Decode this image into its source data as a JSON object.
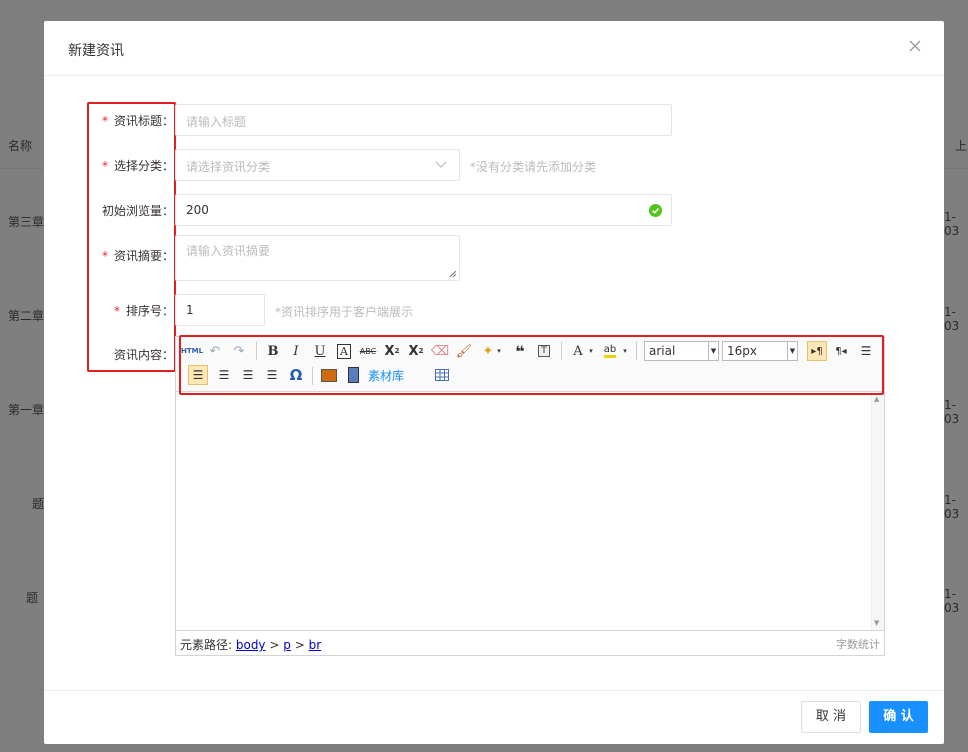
{
  "background": {
    "column_name": "名称",
    "column_upload": "上",
    "rows": [
      {
        "name": "第三章",
        "date": "1-03"
      },
      {
        "name": "第二章",
        "date": "1-03"
      },
      {
        "name": "第一章",
        "date": "1-03"
      },
      {
        "name": "题",
        "date": "1-03"
      },
      {
        "name": "题",
        "date": "1-03"
      }
    ]
  },
  "dialog": {
    "title": "新建资讯",
    "cancel_label": "取 消",
    "confirm_label": "确 认"
  },
  "form": {
    "title_label": "资讯标题：",
    "title_placeholder": "请输入标题",
    "category_label": "选择分类：",
    "category_placeholder": "请选择资讯分类",
    "category_hint": "*没有分类请先添加分类",
    "views_label": "初始浏览量：",
    "views_value": "200",
    "summary_label": "资讯摘要：",
    "summary_placeholder": "请输入资讯摘要",
    "sort_label": "排序号：",
    "sort_value": "1",
    "sort_hint": "*资讯排序用于客户端展示",
    "content_label": "资讯内容："
  },
  "editor": {
    "html_button": "HTML",
    "font_family": "arial",
    "font_size": "16px",
    "material_library": "素材库",
    "path_label": "元素路径: ",
    "path_body": "body",
    "path_p": "p",
    "path_br": "br",
    "path_sep": ">",
    "word_count": "字数统计"
  },
  "colors": {
    "primary": "#1890ff",
    "required": "#f5222d",
    "highlight": "#e02020",
    "success": "#52c41a"
  }
}
